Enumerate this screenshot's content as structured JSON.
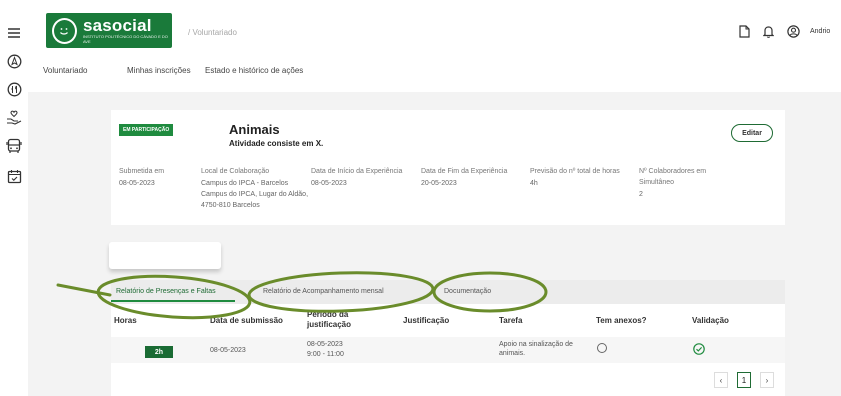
{
  "app": {
    "logo_name": "sasocial",
    "logo_sub": "INSTITUTO POLITÉCNICO DO CÁVADO E DO AVE",
    "breadcrumb": "/ Voluntariado",
    "user_name": "Andrio"
  },
  "nav": {
    "tabs": [
      "Voluntariado",
      "Minhas inscrições",
      "Estado e histórico de ações"
    ]
  },
  "activity": {
    "badge": "EM PARTICIPAÇÃO",
    "title": "Animais",
    "subtitle": "Atividade consiste em X.",
    "edit_label": "Editar",
    "fields": [
      {
        "label": "Submetida em",
        "value": "08-05-2023"
      },
      {
        "label": "Local de Colaboração",
        "value": "Campus do IPCA - Barcelos Campus do IPCA, Lugar do Aldão, 4750-810 Barcelos"
      },
      {
        "label": "Data de Início da Experiência",
        "value": "08-05-2023"
      },
      {
        "label": "Data de Fim da Experiência",
        "value": "20-05-2023"
      },
      {
        "label": "Previsão do nº total de horas",
        "value": "4h"
      },
      {
        "label": "Nº Colaboradores em Simultâneo",
        "value": "2"
      }
    ]
  },
  "report_tabs": [
    "Relatório de Presenças e Faltas",
    "Relatório de Acompanhamento mensal",
    "Documentação"
  ],
  "table": {
    "headers": [
      "Horas",
      "Data de submissão",
      "Período da justificação",
      "Justificação",
      "Tarefa",
      "Tem anexos?",
      "Validação"
    ],
    "rows": [
      {
        "hours": "2h",
        "submitted": "08-05-2023",
        "period_date": "08-05-2023",
        "period_time": "9:00 - 11:00",
        "justification": "",
        "task": "Apoio na sinalização de animais."
      }
    ]
  },
  "pager": {
    "prev": "‹",
    "page": "1",
    "next": "›"
  },
  "colors": {
    "brand": "#1a7a3a",
    "annotation": "#6a8c2b"
  }
}
